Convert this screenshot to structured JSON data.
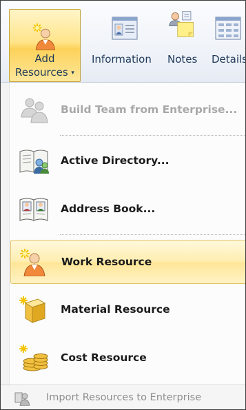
{
  "ribbon": {
    "add_resources": {
      "label_line1": "Add",
      "label_line2": "Resources",
      "caret": "▾"
    },
    "information": {
      "label": "Information"
    },
    "notes": {
      "label": "Notes"
    },
    "details": {
      "label": "Details"
    }
  },
  "menu": {
    "items": [
      {
        "label": "Build Team from Enterprise...",
        "state": "disabled",
        "icon": "team-icon"
      },
      {
        "label": "Active Directory...",
        "state": "normal",
        "icon": "directory-book-icon"
      },
      {
        "label": "Address Book...",
        "state": "normal",
        "icon": "address-book-icon"
      },
      {
        "label": "Work Resource",
        "state": "hover",
        "icon": "work-resource-icon"
      },
      {
        "label": "Material Resource",
        "state": "normal",
        "icon": "material-resource-icon"
      },
      {
        "label": "Cost Resource",
        "state": "normal",
        "icon": "cost-resource-icon"
      }
    ],
    "footer": {
      "label": "Import Resources to Enterprise",
      "icon": "import-resources-icon"
    }
  },
  "colors": {
    "hover_highlight": "#ffeeb0",
    "ribbon_text": "#1e395b",
    "disabled_text": "#a8a8a8"
  }
}
